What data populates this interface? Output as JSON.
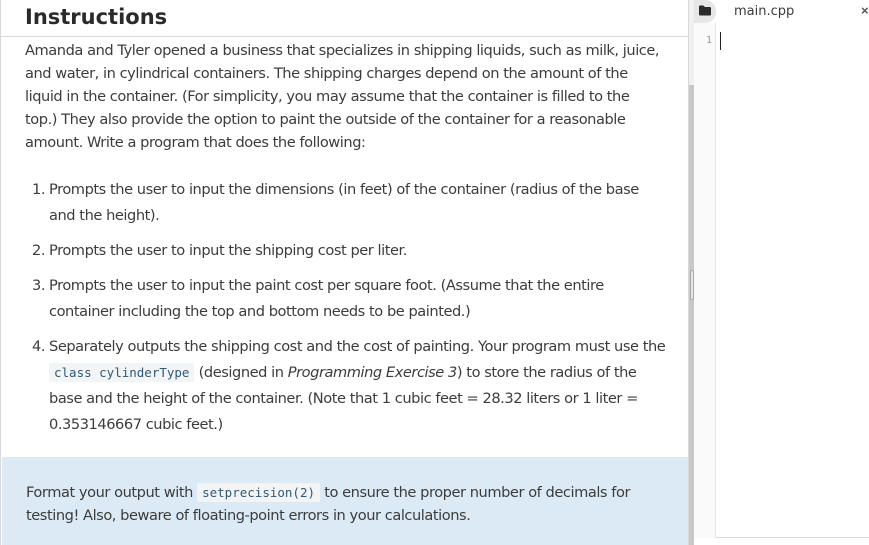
{
  "instructions": {
    "title": "Instructions",
    "intro": "Amanda and Tyler opened a business that specializes in shipping liquids, such as milk, juice, and water, in cylindrical containers. The shipping charges depend on the amount of the liquid in the container. (For simplicity, you may assume that the container is filled to the top.) They also provide the option to paint the outside of the container for a reasonable amount. Write a program that does the following:",
    "steps": [
      {
        "num": "1.",
        "text": "Prompts the user to input the dimensions (in feet) of the container (radius of the base and the height)."
      },
      {
        "num": "2.",
        "text": "Prompts the user to input the shipping cost per liter."
      },
      {
        "num": "3.",
        "text": "Prompts the user to input the paint cost per square foot. (Assume that the entire container including the top and bottom needs to be painted.)"
      },
      {
        "num": "4.",
        "pre": "Separately outputs the shipping cost and the cost of painting. Your program must use the ",
        "code": "class cylinderType",
        "mid": " (designed in ",
        "em": "Programming Exercise 3",
        "post": ") to store the radius of the base and the height of the container. (Note that 1 cubic feet = 28.32 liters or 1 liter = 0.353146667 cubic feet.)"
      }
    ],
    "note": {
      "pre": "Format your output with ",
      "code": "setprecision(2)",
      "post": " to ensure the proper number of decimals for testing! Also, beware of floating-point errors in your calculations."
    }
  },
  "editor": {
    "file_tab": "main.cpp",
    "close_glyph": "×",
    "line_numbers": [
      "1"
    ]
  },
  "colors": {
    "note_background": "#dbeaf5",
    "code_text": "#2e5a7a"
  },
  "icons": {
    "folder": "folder-icon",
    "close": "close-icon"
  }
}
